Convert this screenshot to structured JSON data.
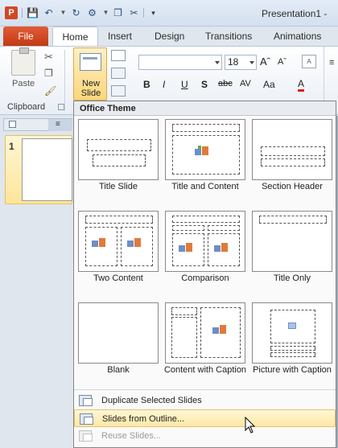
{
  "window": {
    "title": "Presentation1 -",
    "app_icon_letter": "P"
  },
  "quick_access": {
    "icons": [
      "save-icon",
      "undo-icon",
      "redo-icon",
      "repeat-icon",
      "copy-icon",
      "cut-icon",
      "customize-icon"
    ]
  },
  "tabs": [
    {
      "label": "File"
    },
    {
      "label": "Home"
    },
    {
      "label": "Insert"
    },
    {
      "label": "Design"
    },
    {
      "label": "Transitions"
    },
    {
      "label": "Animations"
    }
  ],
  "ribbon": {
    "paste_label": "Paste",
    "new_slide_label": "New Slide",
    "font_size": "18",
    "clipboard_group_label": "Clipboard",
    "format_buttons": [
      "B",
      "I",
      "U",
      "S",
      "abc",
      "AV",
      "Aa",
      "A"
    ]
  },
  "slide_pane": {
    "slide_number": "1"
  },
  "gallery": {
    "header": "Office Theme",
    "layouts": [
      {
        "label": "Title Slide"
      },
      {
        "label": "Title and Content"
      },
      {
        "label": "Section Header"
      },
      {
        "label": "Two Content"
      },
      {
        "label": "Comparison"
      },
      {
        "label": "Title Only"
      },
      {
        "label": "Blank"
      },
      {
        "label": "Content with Caption"
      },
      {
        "label": "Picture with Caption"
      }
    ],
    "menu": [
      {
        "label": "Duplicate Selected Slides",
        "state": "normal"
      },
      {
        "label": "Slides from Outline...",
        "state": "hover"
      },
      {
        "label": "Reuse Slides...",
        "state": "disabled"
      }
    ]
  },
  "colors": {
    "file_tab": "#d24726",
    "hover_fill": "#fde8a6",
    "selected_slide_fill": "#fde59a"
  }
}
